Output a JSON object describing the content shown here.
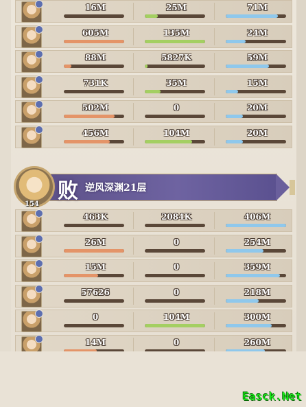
{
  "top_table": {
    "rows": [
      {
        "v1": "16M",
        "f1": 0.0,
        "c1": "orange",
        "v2": "25M",
        "f2": 0.22,
        "c2": "green",
        "v3": "71M",
        "f3": 0.86,
        "c3": "blue"
      },
      {
        "v1": "605M",
        "f1": 1.0,
        "c1": "orange",
        "v2": "135M",
        "f2": 1.0,
        "c2": "green",
        "v3": "24M",
        "f3": 0.33,
        "c3": "blue"
      },
      {
        "v1": "88M",
        "f1": 0.13,
        "c1": "orange",
        "v2": "5827K",
        "f2": 0.04,
        "c2": "green",
        "v3": "59M",
        "f3": 0.72,
        "c3": "blue"
      },
      {
        "v1": "731K",
        "f1": 0.0,
        "c1": "orange",
        "v2": "35M",
        "f2": 0.26,
        "c2": "green",
        "v3": "15M",
        "f3": 0.21,
        "c3": "blue"
      },
      {
        "v1": "502M",
        "f1": 0.84,
        "c1": "orange",
        "v2": "0",
        "f2": 0.0,
        "c2": "green",
        "v3": "20M",
        "f3": 0.28,
        "c3": "blue"
      },
      {
        "v1": "456M",
        "f1": 0.76,
        "c1": "orange",
        "v2": "104M",
        "f2": 0.78,
        "c2": "green",
        "v3": "20M",
        "f3": 0.28,
        "c3": "blue"
      }
    ]
  },
  "banner": {
    "result": "败",
    "stage": "逆风深渊21层",
    "level": "154"
  },
  "bottom_table": {
    "rows": [
      {
        "v1": "463K",
        "f1": 0.0,
        "c1": "orange",
        "v2": "2084K",
        "f2": 0.0,
        "c2": "green",
        "v3": "406M",
        "f3": 1.0,
        "c3": "blue"
      },
      {
        "v1": "26M",
        "f1": 1.0,
        "c1": "orange",
        "v2": "0",
        "f2": 0.0,
        "c2": "green",
        "v3": "254M",
        "f3": 0.63,
        "c3": "blue"
      },
      {
        "v1": "15M",
        "f1": 0.57,
        "c1": "orange",
        "v2": "0",
        "f2": 0.0,
        "c2": "green",
        "v3": "359M",
        "f3": 0.9,
        "c3": "blue"
      },
      {
        "v1": "57626",
        "f1": 0.0,
        "c1": "orange",
        "v2": "0",
        "f2": 0.0,
        "c2": "green",
        "v3": "218M",
        "f3": 0.55,
        "c3": "blue"
      },
      {
        "v1": "0",
        "f1": 0.0,
        "c1": "orange",
        "v2": "104M",
        "f2": 1.0,
        "c2": "green",
        "v3": "300M",
        "f3": 0.76,
        "c3": "blue"
      },
      {
        "v1": "14M",
        "f1": 0.54,
        "c1": "orange",
        "v2": "0",
        "f2": 0.0,
        "c2": "green",
        "v3": "260M",
        "f3": 0.65,
        "c3": "blue"
      }
    ]
  },
  "watermark": "Easck.Net",
  "colors": {
    "orange": "#e49468",
    "green": "#a4cf62",
    "blue": "#8fc8ec"
  }
}
